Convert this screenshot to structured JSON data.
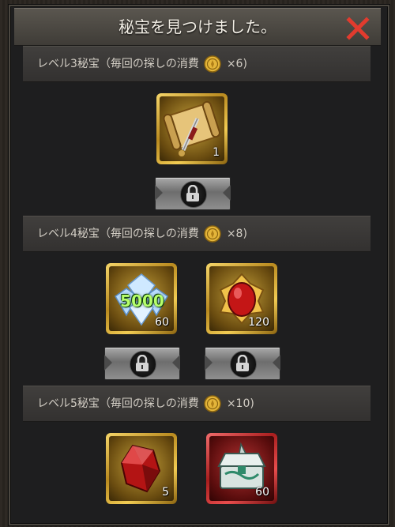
{
  "dialog": {
    "title": "秘宝を見つけました。",
    "close_icon": "close-icon"
  },
  "sections": [
    {
      "label": "レベル3秘宝（毎回の探しの消費",
      "cost": "×6)",
      "items": [
        {
          "icon": "scroll-sword-icon",
          "count": "1",
          "frame": "gold"
        }
      ],
      "locks": 1
    },
    {
      "label": "レベル4秘宝（毎回の探しの消費",
      "cost": "×8)",
      "items": [
        {
          "icon": "diamonds-icon",
          "badge": "5000",
          "count": "60",
          "frame": "gold"
        },
        {
          "icon": "red-gem-emblem-icon",
          "count": "120",
          "frame": "gold"
        }
      ],
      "locks": 2
    },
    {
      "label": "レベル5秘宝（毎回の探しの消費",
      "cost": "×10)",
      "items": [
        {
          "icon": "red-crystal-icon",
          "count": "5",
          "frame": "gold"
        },
        {
          "icon": "jade-chest-icon",
          "count": "60",
          "frame": "red"
        }
      ],
      "locks": 0
    }
  ],
  "colors": {
    "accent_gold": "#e8b935",
    "accent_red": "#d63a3a",
    "close_red": "#e23b2e"
  }
}
